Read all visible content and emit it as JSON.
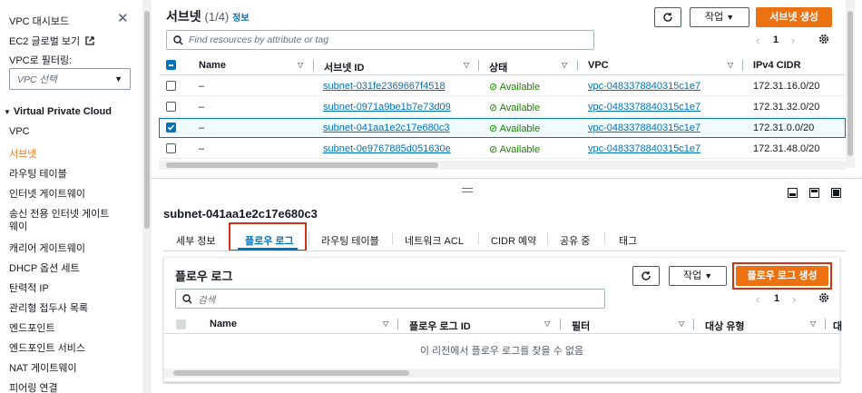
{
  "sidebar": {
    "items": [
      "VPC 대시보드",
      "EC2 글로벌 보기",
      "VPC로 필터링:"
    ],
    "vpc_select_placeholder": "VPC 선택",
    "section_title": "Virtual Private Cloud",
    "nav": [
      "VPC",
      "서브넷",
      "라우팅 테이블",
      "인터넷 게이트웨이",
      "송신 전용 인터넷 게이트",
      "웨이",
      "캐리어 게이트웨이",
      "DHCP 옵션 세트",
      "탄력적 IP",
      "관리형 접두사 목록",
      "엔드포인트",
      "엔드포인트 서비스",
      "NAT 게이트웨이",
      "피어링 연결"
    ]
  },
  "subnets": {
    "title": "서브넷",
    "count": "(1/4)",
    "info": "정보",
    "actions_label": "작업",
    "create_label": "서브넷 생성",
    "search_placeholder": "Find resources by attribute or tag",
    "page": "1",
    "columns": [
      "Name",
      "서브넷 ID",
      "상태",
      "VPC",
      "IPv4 CIDR"
    ],
    "rows": [
      {
        "name": "–",
        "id": "subnet-031fe2369667f4518",
        "status": "Available",
        "vpc": "vpc-0483378840315c1e7",
        "cidr": "172.31.16.0/20",
        "selected": false
      },
      {
        "name": "–",
        "id": "subnet-0971a9be1b7e73d09",
        "status": "Available",
        "vpc": "vpc-0483378840315c1e7",
        "cidr": "172.31.32.0/20",
        "selected": false
      },
      {
        "name": "–",
        "id": "subnet-041aa1e2c17e680c3",
        "status": "Available",
        "vpc": "vpc-0483378840315c1e7",
        "cidr": "172.31.0.0/20",
        "selected": true
      },
      {
        "name": "–",
        "id": "subnet-0e9767885d051630e",
        "status": "Available",
        "vpc": "vpc-0483378840315c1e7",
        "cidr": "172.31.48.0/20",
        "selected": false
      }
    ]
  },
  "detail": {
    "subnet_id": "subnet-041aa1e2c17e680c3",
    "tabs": [
      "세부 정보",
      "플로우 로그",
      "라우팅 테이블",
      "네트워크 ACL",
      "CIDR 예약",
      "공유 중",
      "태그"
    ],
    "active_tab": "플로우 로그"
  },
  "flowlogs": {
    "title": "플로우 로그",
    "actions_label": "작업",
    "create_label": "플로우 로그 생성",
    "search_placeholder": "검색",
    "page": "1",
    "columns": [
      "Name",
      "플로우 로그 ID",
      "필터",
      "대상 유형",
      "대"
    ],
    "empty_message": "이 리전에서 플로우 로그를 찾을 수 없음"
  },
  "colors": {
    "accent": "#ec7211",
    "link": "#0073bb",
    "success": "#1d8102",
    "highlight": "#d13212"
  }
}
